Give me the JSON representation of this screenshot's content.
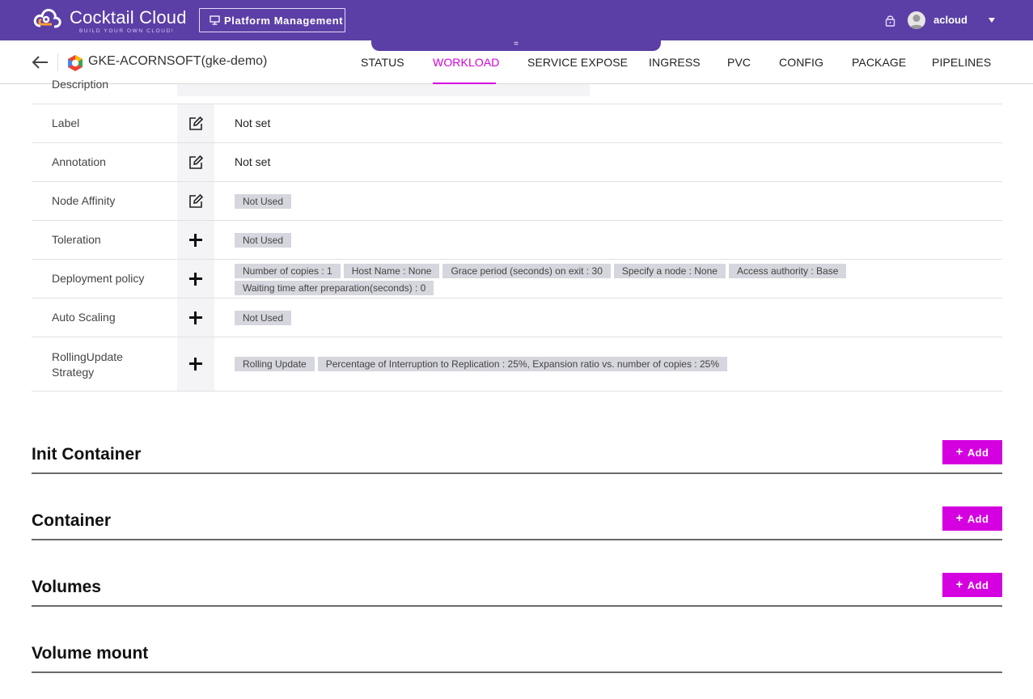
{
  "app": {
    "brand": "Cocktail Cloud",
    "tagline": "BUILD YOUR OWN CLOUD!",
    "platform_button": "Platform Management",
    "username": "acloud",
    "drawer_handle": "=",
    "colors": {
      "header": "#5b3fa6",
      "accent": "#d500e0"
    }
  },
  "subheader": {
    "cluster": "GKE-ACORNSOFT(gke-demo)",
    "tabs": [
      {
        "label": "STATUS",
        "active": false
      },
      {
        "label": "WORKLOAD",
        "active": true
      },
      {
        "label": "SERVICE EXPOSE",
        "active": false
      },
      {
        "label": "INGRESS",
        "active": false
      },
      {
        "label": "PVC",
        "active": false
      },
      {
        "label": "CONFIG",
        "active": false
      },
      {
        "label": "PACKAGE",
        "active": false
      },
      {
        "label": "PIPELINES",
        "active": false
      }
    ]
  },
  "table": {
    "description_label": "Description",
    "rows": [
      {
        "label": "Label",
        "icon": "edit-icon",
        "value": "Not set"
      },
      {
        "label": "Annotation",
        "icon": "edit-icon",
        "value": "Not set"
      },
      {
        "label": "Node Affinity",
        "icon": "edit-icon",
        "chips": [
          "Not Used"
        ]
      },
      {
        "label": "Toleration",
        "icon": "plus-icon",
        "chips": [
          "Not Used"
        ]
      },
      {
        "label": "Deployment policy",
        "icon": "plus-icon",
        "chips": [
          "Number of copies : 1",
          "Host Name : None",
          "Grace period (seconds) on exit : 30",
          "Specify a node : None",
          "Access authority : Base",
          "Waiting time after preparation(seconds) : 0"
        ]
      },
      {
        "label": "Auto Scaling",
        "icon": "plus-icon",
        "chips": [
          "Not Used"
        ]
      },
      {
        "label_line1": "RollingUpdate",
        "label_line2": "Strategy",
        "icon": "plus-icon",
        "chips": [
          "Rolling Update",
          "Percentage of Interruption to Replication : 25%, Expansion ratio vs. number of copies : 25%"
        ]
      }
    ]
  },
  "sections": [
    {
      "title": "Init Container",
      "add_label": "Add"
    },
    {
      "title": "Container",
      "add_label": "Add"
    },
    {
      "title": "Volumes",
      "add_label": "Add"
    },
    {
      "title": "Volume mount"
    }
  ]
}
